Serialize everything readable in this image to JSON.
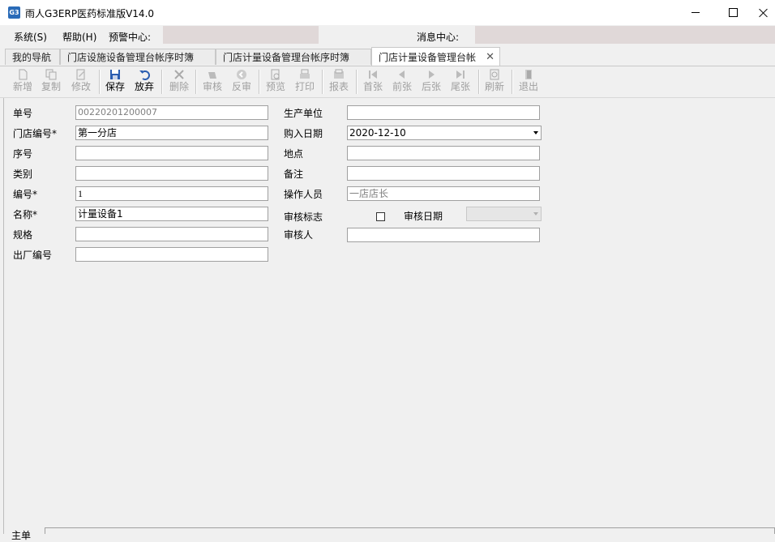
{
  "window": {
    "title": "雨人G3ERP医药标准版V14.0",
    "icon": "app-logo-icon"
  },
  "menubar": {
    "system": "系统(S)",
    "help": "帮助(H)",
    "alert_center": "预警中心:",
    "message_center": "消息中心:"
  },
  "tabs": [
    {
      "label": "我的导航"
    },
    {
      "label": "门店设施设备管理台帐序时簿"
    },
    {
      "label": "门店计量设备管理台帐序时簿"
    },
    {
      "label": "门店计量设备管理台帐",
      "active": true,
      "close": "✕"
    }
  ],
  "toolbar": {
    "new": "新增",
    "copy": "复制",
    "edit": "修改",
    "save": "保存",
    "discard": "放弃",
    "delete": "删除",
    "audit": "审核",
    "unaudit": "反审",
    "preview": "预览",
    "print": "打印",
    "report": "报表",
    "first": "首张",
    "prev": "前张",
    "next": "后张",
    "last": "尾张",
    "refresh": "刷新",
    "exit": "退出"
  },
  "form": {
    "doc_no": {
      "label": "单号",
      "value": "00220201200007"
    },
    "store_code": {
      "label": "门店编号*",
      "value": "第一分店"
    },
    "seq_no": {
      "label": "序号",
      "value": ""
    },
    "category": {
      "label": "类别",
      "value": ""
    },
    "code": {
      "label": "编号*",
      "value": "1"
    },
    "name": {
      "label": "名称*",
      "value": "计量设备1"
    },
    "spec": {
      "label": "规格",
      "value": ""
    },
    "factory_no": {
      "label": "出厂编号",
      "value": ""
    },
    "manufacturer": {
      "label": "生产单位",
      "value": ""
    },
    "purchase_date": {
      "label": "购入日期",
      "value": "2020-12-10"
    },
    "location": {
      "label": "地点",
      "value": ""
    },
    "remark": {
      "label": "备注",
      "value": ""
    },
    "operator": {
      "label": "操作人员",
      "value": "一店店长"
    },
    "audit_flag": {
      "label": "审核标志",
      "checked": false
    },
    "audit_date": {
      "label": "审核日期",
      "value": ""
    },
    "auditor": {
      "label": "审核人",
      "value": ""
    }
  },
  "bottom": {
    "label": "主单"
  },
  "colors": {
    "accent": "#2a6bb8",
    "alert_box": "#e0d8d8"
  }
}
